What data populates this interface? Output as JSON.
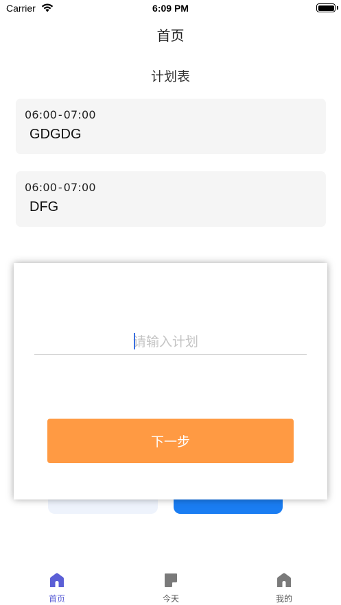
{
  "status_bar": {
    "carrier": "Carrier",
    "time": "6:09 PM"
  },
  "nav": {
    "title": "首页"
  },
  "section": {
    "title": "计划表"
  },
  "plans": [
    {
      "time": "06:00 - 07:00",
      "text": "GDGDG"
    },
    {
      "time": "06:00 - 07:00",
      "text": "DFG"
    }
  ],
  "modal": {
    "input_placeholder": "请输入计划",
    "input_value": "",
    "next_label": "下一步"
  },
  "tabs": [
    {
      "label": "首页",
      "icon": "home-icon",
      "active": true
    },
    {
      "label": "今天",
      "icon": "note-icon",
      "active": false
    },
    {
      "label": "我的",
      "icon": "home-icon",
      "active": false
    }
  ],
  "colors": {
    "accent": "#5b5fd6",
    "next_button": "#ff9a43",
    "primary_blue": "#1a7df2",
    "card_bg": "#f5f5f5"
  }
}
